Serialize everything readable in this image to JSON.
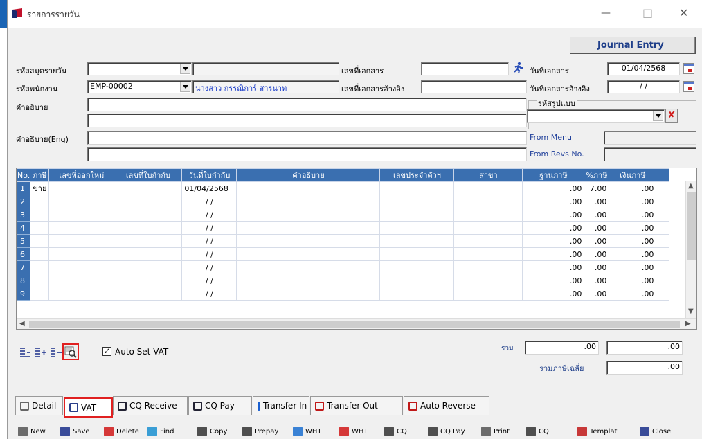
{
  "window": {
    "title": "รายการรายวัน",
    "minimize_glyph": "—",
    "maximize_glyph": "□",
    "close_glyph": "✕"
  },
  "banner": "Journal Entry",
  "form": {
    "journal_code_label": "รหัสสมุดรายวัน",
    "journal_code_value": "",
    "journal_name_value": "",
    "doc_no_label": "เลขที่เอกสาร",
    "doc_no_value": "",
    "doc_date_label": "วันที่เอกสาร",
    "doc_date_value": "01/04/2568",
    "employee_label": "รหัสพนักงาน",
    "employee_code_value": "EMP-00002",
    "employee_name_value": "นางสาว กรรณิการ์ สารนาท",
    "ref_doc_label": "เลขที่เอกสารอ้างอิง",
    "ref_doc_value": "",
    "ref_date_label": "วันที่เอกสารอ้างอิง",
    "ref_date_value": "/ /",
    "desc_label": "คำอธิบาย",
    "desc_value_1": "",
    "desc_value_2": "",
    "template_label": "รหัสรูปแบบ",
    "template_value": "",
    "template_clear_glyph": "✘",
    "desc_eng_label": "คำอธิบาย(Eng)",
    "desc_eng_value_1": "",
    "desc_eng_value_2": "",
    "from_menu_label": "From Menu",
    "from_menu_value": "",
    "from_revs_label": "From Revs No.",
    "from_revs_value": ""
  },
  "grid": {
    "headers": [
      "No.",
      "ภาษี",
      "เลขที่ออกใหม่",
      "เลขที่ใบกำกับ",
      "วันที่ใบกำกับ",
      "คำอธิบาย",
      "เลขประจำตัวฯ",
      "สาขา",
      "ฐานภาษี",
      "%ภาษี",
      "เงินภาษี"
    ],
    "rows": [
      {
        "no": "1",
        "tax": "ขาย",
        "new_no": "",
        "inv_no": "",
        "inv_date": "01/04/2568",
        "desc": "",
        "tax_id": "",
        "branch": "",
        "base": ".00",
        "pct": "7.00",
        "vat": ".00"
      },
      {
        "no": "2",
        "tax": "",
        "new_no": "",
        "inv_no": "",
        "inv_date": "/ /",
        "desc": "",
        "tax_id": "",
        "branch": "",
        "base": ".00",
        "pct": ".00",
        "vat": ".00"
      },
      {
        "no": "3",
        "tax": "",
        "new_no": "",
        "inv_no": "",
        "inv_date": "/ /",
        "desc": "",
        "tax_id": "",
        "branch": "",
        "base": ".00",
        "pct": ".00",
        "vat": ".00"
      },
      {
        "no": "4",
        "tax": "",
        "new_no": "",
        "inv_no": "",
        "inv_date": "/ /",
        "desc": "",
        "tax_id": "",
        "branch": "",
        "base": ".00",
        "pct": ".00",
        "vat": ".00"
      },
      {
        "no": "5",
        "tax": "",
        "new_no": "",
        "inv_no": "",
        "inv_date": "/ /",
        "desc": "",
        "tax_id": "",
        "branch": "",
        "base": ".00",
        "pct": ".00",
        "vat": ".00"
      },
      {
        "no": "6",
        "tax": "",
        "new_no": "",
        "inv_no": "",
        "inv_date": "/ /",
        "desc": "",
        "tax_id": "",
        "branch": "",
        "base": ".00",
        "pct": ".00",
        "vat": ".00"
      },
      {
        "no": "7",
        "tax": "",
        "new_no": "",
        "inv_no": "",
        "inv_date": "/ /",
        "desc": "",
        "tax_id": "",
        "branch": "",
        "base": ".00",
        "pct": ".00",
        "vat": ".00"
      },
      {
        "no": "8",
        "tax": "",
        "new_no": "",
        "inv_no": "",
        "inv_date": "/ /",
        "desc": "",
        "tax_id": "",
        "branch": "",
        "base": ".00",
        "pct": ".00",
        "vat": ".00"
      },
      {
        "no": "9",
        "tax": "",
        "new_no": "",
        "inv_no": "",
        "inv_date": "/ /",
        "desc": "",
        "tax_id": "",
        "branch": "",
        "base": ".00",
        "pct": ".00",
        "vat": ".00"
      }
    ]
  },
  "auto_vat": {
    "label": "Auto Set VAT",
    "checked": true
  },
  "totals": {
    "total_label": "รวม",
    "total_base": ".00",
    "total_vat": ".00",
    "avg_label": "รวมภาษีเฉลี่ย",
    "avg_value": ".00"
  },
  "tabs": [
    {
      "label": "Detail",
      "icon": "detail-icon"
    },
    {
      "label": "VAT",
      "icon": "vat-icon"
    },
    {
      "label": "CQ Receive",
      "icon": "cheque-receive-icon"
    },
    {
      "label": "CQ Pay",
      "icon": "cheque-pay-icon"
    },
    {
      "label": "Transfer In",
      "icon": "transfer-in-icon"
    },
    {
      "label": "Transfer Out",
      "icon": "transfer-out-icon"
    },
    {
      "label": "Auto Reverse",
      "icon": "auto-reverse-icon"
    }
  ],
  "toolbar": [
    {
      "label": "New",
      "icon": "new-icon"
    },
    {
      "label": "Save",
      "icon": "save-icon"
    },
    {
      "label": "Delete",
      "icon": "delete-icon"
    },
    {
      "label": "Find",
      "icon": "find-icon"
    },
    {
      "label": "Copy",
      "icon": "copy-icon"
    },
    {
      "label": "Prepay",
      "icon": "prepay-icon"
    },
    {
      "label": "WHT",
      "icon": "wht-icon"
    },
    {
      "label": "WHT",
      "icon": "wht-icon"
    },
    {
      "label": "CQ",
      "icon": "cq-icon"
    },
    {
      "label": "CQ Pay",
      "icon": "cq-pay-icon"
    },
    {
      "label": "Print",
      "icon": "print-icon"
    },
    {
      "label": "CQ",
      "icon": "cq-icon"
    },
    {
      "label": "Templat",
      "icon": "template-icon"
    },
    {
      "label": "Close",
      "icon": "close-icon"
    }
  ],
  "colors": {
    "grid_header": "#3a6fb0",
    "highlight": "#e02020",
    "banner_text": "#1f3f8a",
    "employee_name": "#1a3cc8"
  }
}
